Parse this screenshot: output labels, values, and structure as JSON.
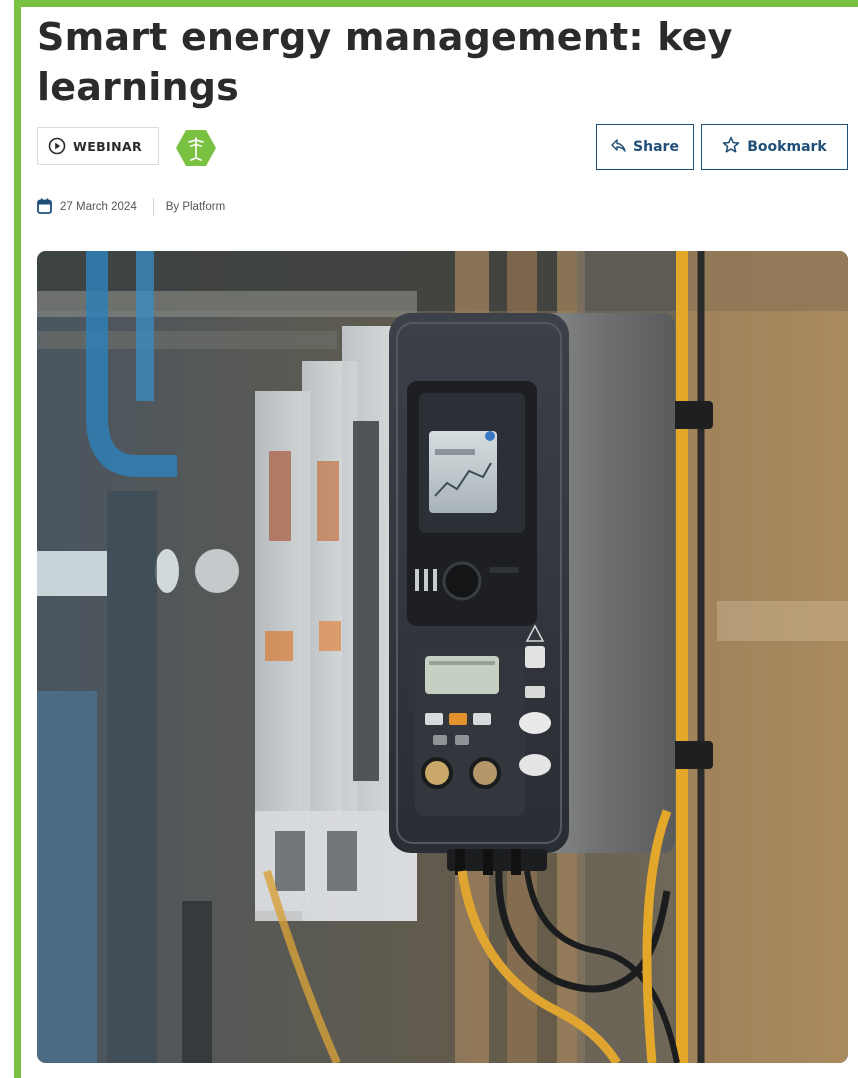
{
  "article": {
    "title": "Smart energy management: key learnings",
    "type_label": "WEBINAR",
    "date": "27 March 2024",
    "author": "By Platform"
  },
  "actions": {
    "share_label": "Share",
    "bookmark_label": "Bookmark"
  },
  "icons": {
    "type": "play-circle-icon",
    "topic": "energy-topic-hexagon-icon",
    "share": "share-icon",
    "bookmark": "star-icon",
    "date": "calendar-icon"
  },
  "colors": {
    "frame": "#7ac142",
    "topic_badge": "#7ac142",
    "button_accent": "#1f4e79",
    "calendar_icon": "#1f4e79",
    "title_text": "#2b2b2b"
  }
}
